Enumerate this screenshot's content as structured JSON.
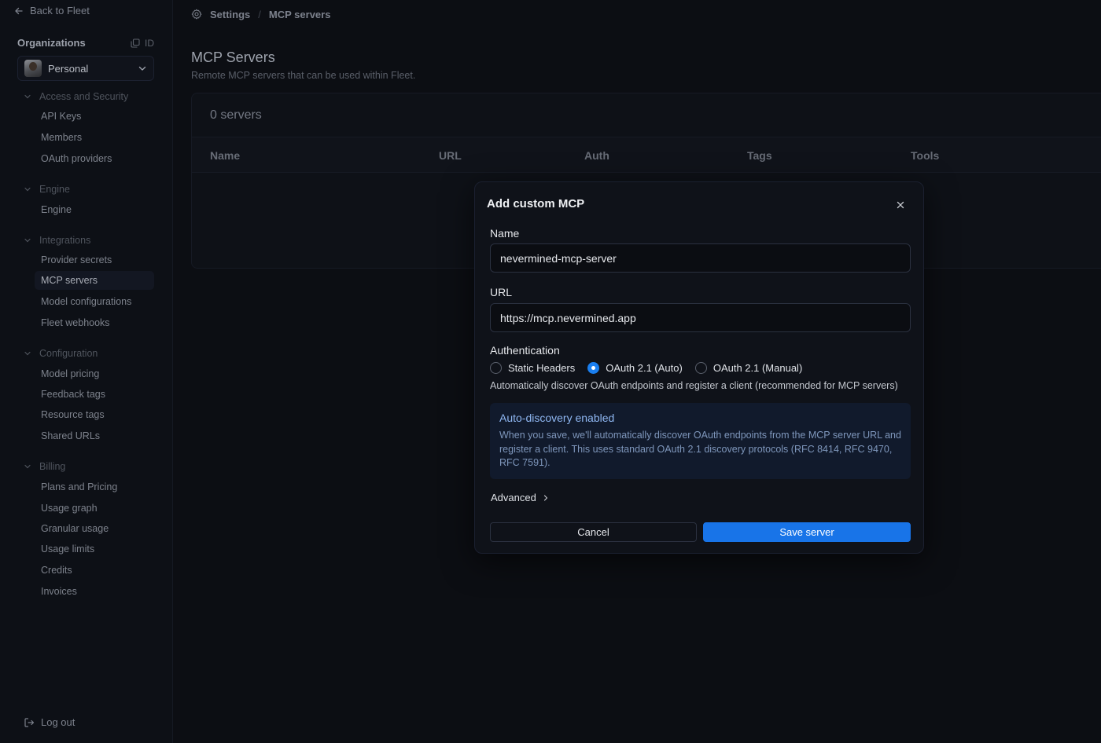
{
  "sidebar": {
    "back_label": "Back to Fleet",
    "org_title": "Organizations",
    "org_id_label": "ID",
    "org_selected": "Personal",
    "sections": [
      {
        "label": "Access and Security",
        "items": [
          "API Keys",
          "Members",
          "OAuth providers"
        ]
      },
      {
        "label": "Engine",
        "items": [
          "Engine"
        ]
      },
      {
        "label": "Integrations",
        "items": [
          "Provider secrets",
          "MCP servers",
          "Model configurations",
          "Fleet webhooks"
        ]
      },
      {
        "label": "Configuration",
        "items": [
          "Model pricing",
          "Feedback tags",
          "Resource tags",
          "Shared URLs"
        ]
      },
      {
        "label": "Billing",
        "items": [
          "Plans and Pricing",
          "Usage graph",
          "Granular usage",
          "Usage limits",
          "Credits",
          "Invoices"
        ]
      }
    ],
    "active_item": "MCP servers",
    "logout_label": "Log out"
  },
  "breadcrumb": {
    "root": "Settings",
    "separator": "/",
    "current": "MCP servers"
  },
  "page": {
    "title": "MCP Servers",
    "subtitle": "Remote MCP servers that can be used within Fleet.",
    "count_label": "0 servers",
    "columns": [
      "Name",
      "URL",
      "Auth",
      "Tags",
      "Tools"
    ]
  },
  "modal": {
    "title": "Add custom MCP",
    "name_label": "Name",
    "name_value": "nevermined-mcp-server",
    "url_label": "URL",
    "url_value": "https://mcp.nevermined.app",
    "auth_label": "Authentication",
    "auth_options": [
      "Static Headers",
      "OAuth 2.1 (Auto)",
      "OAuth 2.1 (Manual)"
    ],
    "auth_selected": "OAuth 2.1 (Auto)",
    "auth_help": "Automatically discover OAuth endpoints and register a client (recommended for MCP servers)",
    "info_title": "Auto-discovery enabled",
    "info_text": "When you save, we'll automatically discover OAuth endpoints from the MCP server URL and register a client. This uses standard OAuth 2.1 discovery protocols (RFC 8414, RFC 9470, RFC 7591).",
    "advanced_label": "Advanced",
    "cancel_label": "Cancel",
    "save_label": "Save server"
  },
  "colors": {
    "background": "#0c0e13",
    "modal_bg": "#0f1219",
    "accent": "#1874e8",
    "info_bg": "#111a2c",
    "info_title": "#8fb7f2"
  }
}
